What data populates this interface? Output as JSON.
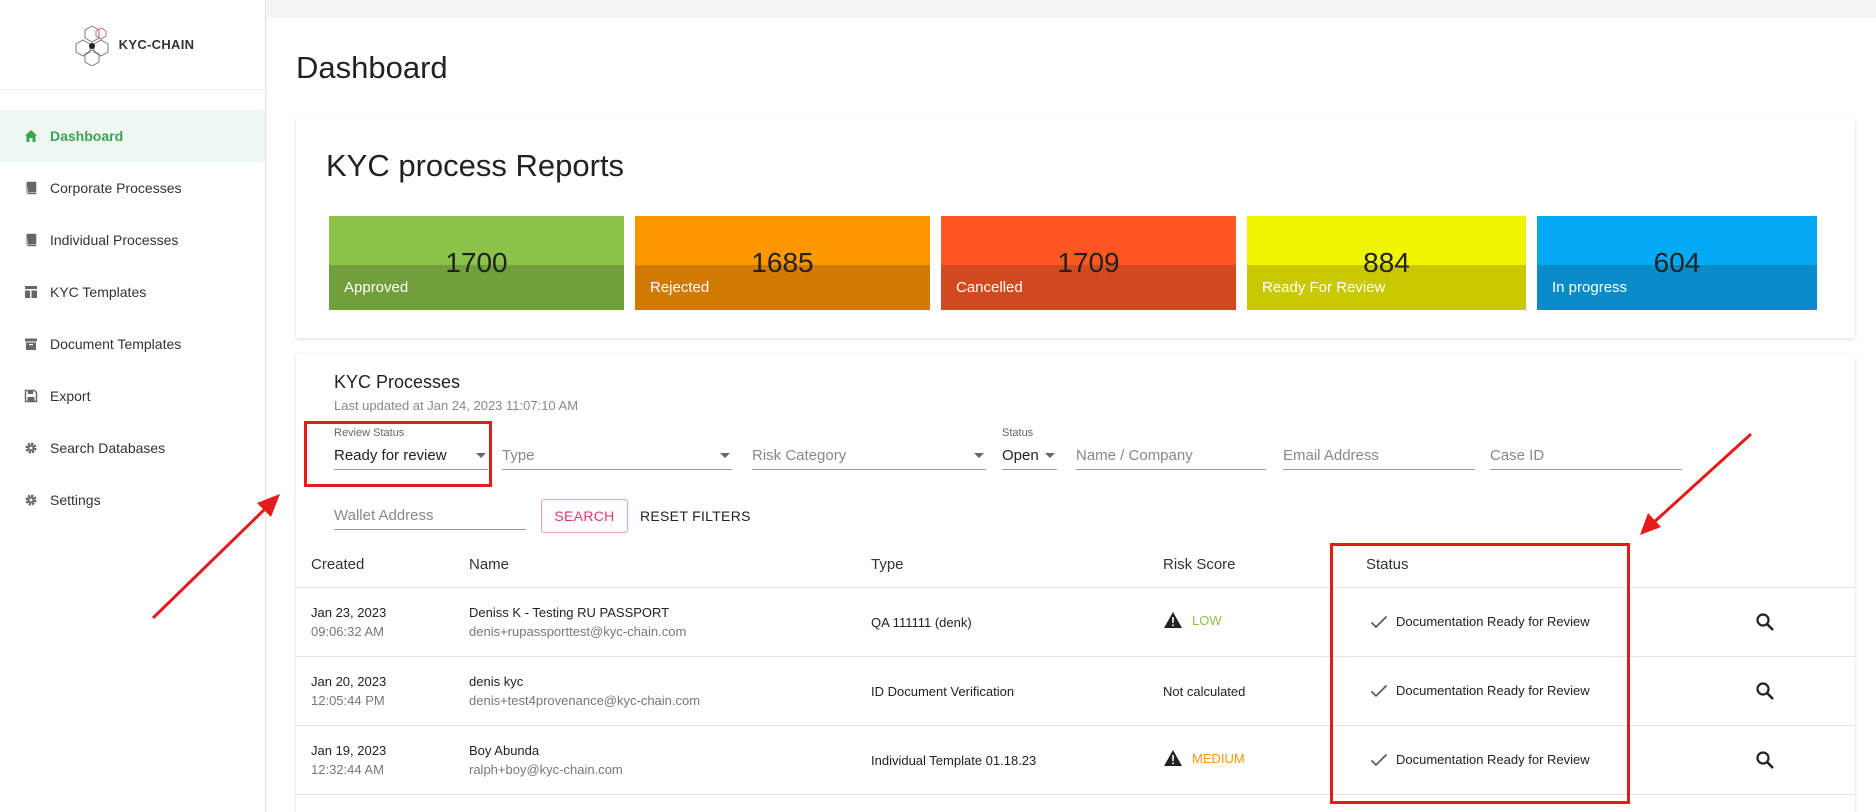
{
  "app": {
    "logo_text": "KYC-CHAIN"
  },
  "sidebar": {
    "items": [
      {
        "label": "Dashboard",
        "icon": "home-icon",
        "active": true
      },
      {
        "label": "Corporate Processes",
        "icon": "book-icon"
      },
      {
        "label": "Individual Processes",
        "icon": "book-icon"
      },
      {
        "label": "KYC Templates",
        "icon": "template-icon"
      },
      {
        "label": "Document Templates",
        "icon": "archive-icon"
      },
      {
        "label": "Export",
        "icon": "save-icon"
      },
      {
        "label": "Search Databases",
        "icon": "gear-icon"
      },
      {
        "label": "Settings",
        "icon": "gear-icon"
      }
    ]
  },
  "page": {
    "title": "Dashboard"
  },
  "reports": {
    "title": "KYC process Reports",
    "tiles": [
      {
        "label": "Approved",
        "count": "1700",
        "color_top": "#8bc34a",
        "color_bottom": "#709f3b"
      },
      {
        "label": "Rejected",
        "count": "1685",
        "color_top": "#ff9800",
        "color_bottom": "#d07a02"
      },
      {
        "label": "Cancelled",
        "count": "1709",
        "color_top": "#ff5722",
        "color_bottom": "#d14a1f"
      },
      {
        "label": "Ready For Review",
        "count": "884",
        "color_top": "#f1f600",
        "color_bottom": "#c8c900"
      },
      {
        "label": "In progress",
        "count": "604",
        "color_top": "#03a9f4",
        "color_bottom": "#078cc9"
      }
    ]
  },
  "processes": {
    "title": "KYC Processes",
    "updated": "Last updated at Jan 24, 2023 11:07:10 AM",
    "filters": {
      "review_status_label": "Review Status",
      "review_status_value": "Ready for review",
      "type_placeholder": "Type",
      "risk_placeholder": "Risk Category",
      "status_label": "Status",
      "status_value": "Open",
      "name_placeholder": "Name / Company",
      "email_placeholder": "Email Address",
      "case_placeholder": "Case ID",
      "wallet_placeholder": "Wallet Address",
      "search_label": "SEARCH",
      "reset_label": "RESET FILTERS"
    },
    "columns": {
      "created": "Created",
      "name": "Name",
      "type": "Type",
      "risk": "Risk Score",
      "status": "Status"
    },
    "rows": [
      {
        "date": "Jan 23, 2023",
        "time": "09:06:32 AM",
        "name": "Deniss K - Testing RU PASSPORT",
        "email": "denis+rupassporttest@kyc-chain.com",
        "type": "QA 111111 (denk)",
        "risk": "LOW",
        "risk_color": "#8bc34a",
        "risk_warn": true,
        "status": "Documentation Ready for Review"
      },
      {
        "date": "Jan 20, 2023",
        "time": "12:05:44 PM",
        "name": "denis kyc",
        "email": "denis+test4provenance@kyc-chain.com",
        "type": "ID Document Verification",
        "risk": "Not calculated",
        "risk_color": "#222222",
        "risk_warn": false,
        "status": "Documentation Ready for Review"
      },
      {
        "date": "Jan 19, 2023",
        "time": "12:32:44 AM",
        "name": "Boy Abunda",
        "email": "ralph+boy@kyc-chain.com",
        "type": "Individual Template 01.18.23",
        "risk": "MEDIUM",
        "risk_color": "#ff9800",
        "risk_warn": true,
        "status": "Documentation Ready for Review"
      }
    ]
  },
  "annotation": {
    "color": "#e21b1b"
  }
}
